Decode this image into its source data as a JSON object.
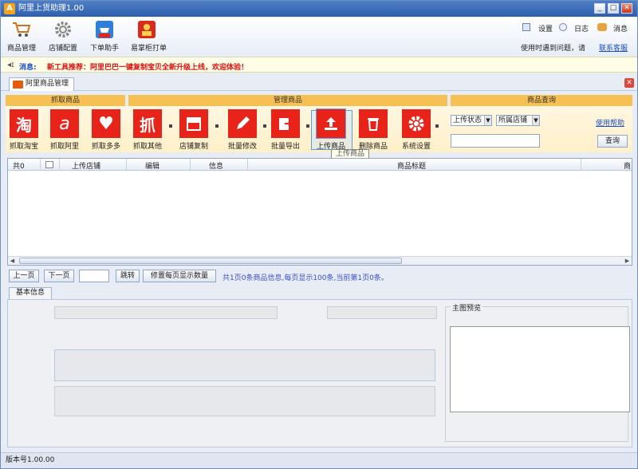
{
  "window": {
    "title": "阿里上货助理1.00",
    "minimize": "_",
    "maximize": "□",
    "close": "✕"
  },
  "toolbar": {
    "items": [
      {
        "label": "商品管理",
        "icon": "cart-icon"
      },
      {
        "label": "店铺配置",
        "icon": "gear-icon"
      },
      {
        "label": "下单助手",
        "icon": "order-helper-icon",
        "badge": "助手"
      },
      {
        "label": "易掌柜打单",
        "icon": "print-order-icon"
      }
    ],
    "right": {
      "settings": "设置",
      "log": "日志",
      "messages": "消息",
      "help_text": "使用时遇到问题，请",
      "contact": "联系客服"
    }
  },
  "message": {
    "label": "消息:",
    "text": "新工具推荐：阿里巴巴一键复制宝贝全新升级上线，欢迎体验！"
  },
  "tab": {
    "label": "阿里商品管理"
  },
  "groups": {
    "fetch": "抓取商品",
    "manage": "管理商品",
    "query": "商品查询"
  },
  "ribbon": {
    "buttons": [
      {
        "label": "抓取淘宝",
        "glyph": "淘"
      },
      {
        "label": "抓取阿里",
        "glyph": "a"
      },
      {
        "label": "抓取多多",
        "glyph": "♥"
      },
      {
        "label": "抓取其他",
        "glyph": "抓"
      },
      {
        "label": "店铺复制",
        "glyph": "store"
      },
      {
        "label": "批量修改",
        "glyph": "pencil"
      },
      {
        "label": "批量导出",
        "glyph": "export"
      },
      {
        "label": "上传商品",
        "glyph": "upload"
      },
      {
        "label": "删除商品",
        "glyph": "trash"
      },
      {
        "label": "系统设置",
        "glyph": "gear"
      }
    ]
  },
  "query": {
    "status_label": "上传状态",
    "shop_label": "所属店铺",
    "help": "使用帮助",
    "search": "查询"
  },
  "tooltip": "上传商品",
  "grid": {
    "columns": [
      "共0",
      "上传店铺",
      "编辑",
      "信息",
      "商品标题",
      "商"
    ]
  },
  "pager": {
    "prev": "上一页",
    "next": "下一页",
    "page_value": "",
    "jump": "跳转",
    "page_size": "修置每页显示数量",
    "info": "共1页0条商品信息,每页显示100条,当前第1页0条。"
  },
  "detail": {
    "tab": "基本信息",
    "pic_title": "主图预览"
  },
  "status": {
    "version": "版本号1.00.00"
  },
  "colors": {
    "accent": "#e8231a",
    "group_head": "#f6c052",
    "title": "#2e5fae"
  }
}
